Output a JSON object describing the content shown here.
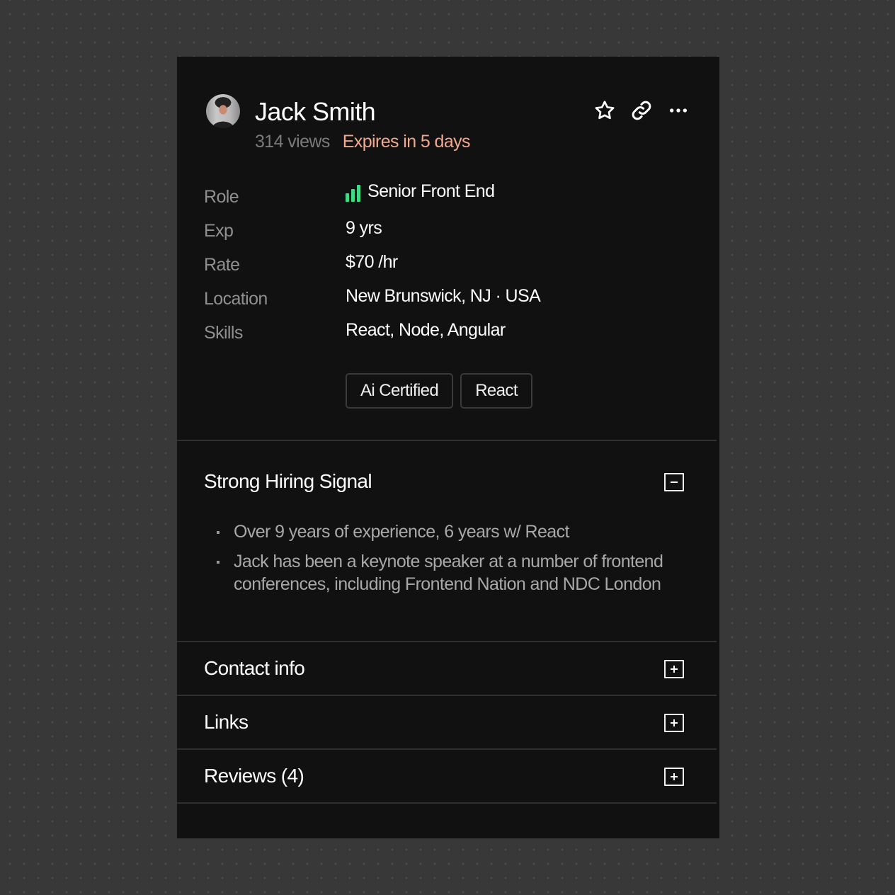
{
  "profile": {
    "name": "Jack Smith",
    "views": "314 views",
    "expires": "Expires in 5 days",
    "avatar_alt": "Jack Smith avatar"
  },
  "actions": [
    {
      "name": "favorite",
      "icon": "star-icon"
    },
    {
      "name": "copy-link",
      "icon": "link-icon"
    },
    {
      "name": "more",
      "icon": "more-horizontal-icon"
    }
  ],
  "fields": [
    {
      "label": "Role",
      "value": "Senior Front End",
      "icon": "signal-bars-icon",
      "level": "3 of 3"
    },
    {
      "label": "Exp",
      "value": "9 yrs"
    },
    {
      "label": "Rate",
      "value": "$70 /hr"
    },
    {
      "label": "Location",
      "value": "New Brunswick, NJ · USA"
    },
    {
      "label": "Skills",
      "value": "React, Node, Angular"
    }
  ],
  "tags": [
    "Ai Certified",
    "React"
  ],
  "sections": {
    "hiring_signal": {
      "title": "Strong Hiring Signal",
      "expanded": true,
      "bullets": [
        "Over 9 years of experience, 6 years w/ React",
        "Jack has been a keynote speaker at a number of frontend conferences, including Frontend Nation and NDC London"
      ]
    },
    "contact": {
      "title": "Contact info",
      "expanded": false
    },
    "links": {
      "title": "Links",
      "expanded": false
    },
    "reviews": {
      "title": "Reviews (4)",
      "expanded": false
    }
  },
  "colors": {
    "background": "#383838",
    "card": "#111111",
    "accent_expires": "#f2a78f",
    "signal_green": "#3ddc84",
    "muted_text": "#8f8f8f"
  }
}
